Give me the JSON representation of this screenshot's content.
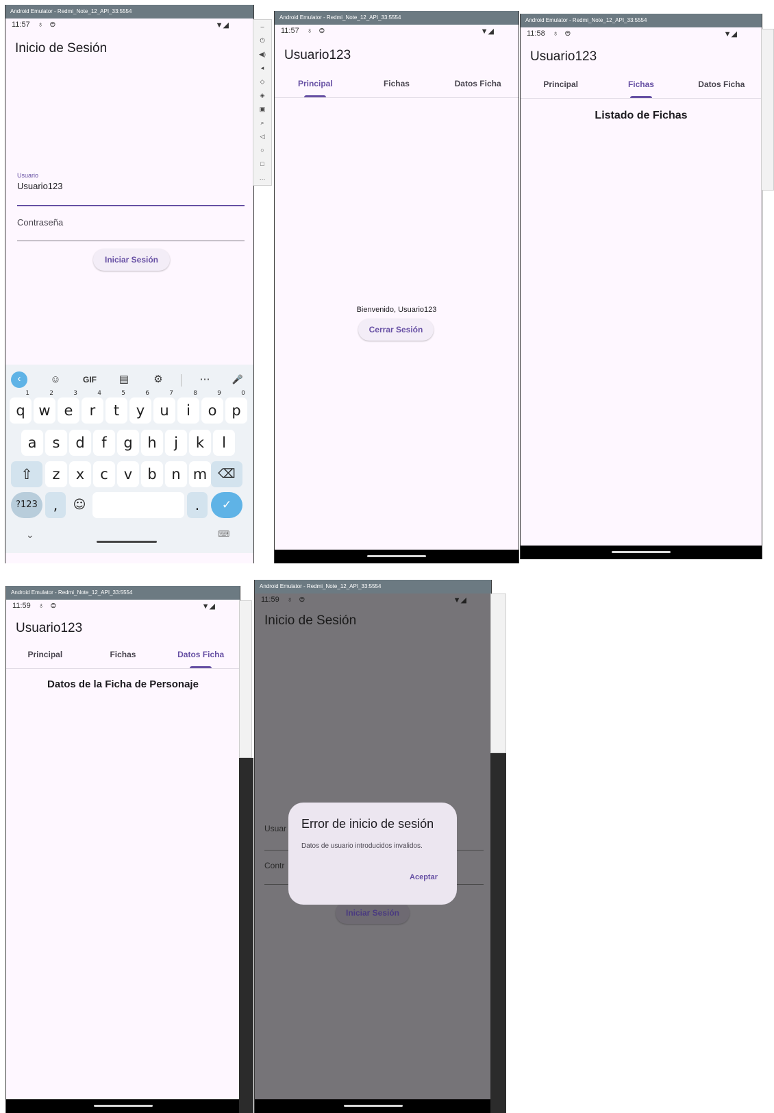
{
  "emulator_title": "Android Emulator - Redmi_Note_12_API_33:5554",
  "status_icons": "♁ ⊜",
  "signal": "▼◢",
  "side_panel_icons": [
    "–",
    "⏻",
    "◀)",
    "◂",
    "◇",
    "◈",
    "▣",
    "⌕",
    "◁",
    "○",
    "□",
    "…"
  ],
  "login": {
    "time": "11:57",
    "title": "Inicio de Sesión",
    "user_label": "Usuario",
    "user_value": "Usuario123",
    "password_placeholder": "Contraseña",
    "login_button": "Iniciar Sesión"
  },
  "keyboard": {
    "toolbar": [
      "‹",
      "☺",
      "GIF",
      "▤",
      "⚙",
      "⋯",
      "🎤"
    ],
    "row1": [
      "q",
      "w",
      "e",
      "r",
      "t",
      "y",
      "u",
      "i",
      "o",
      "p"
    ],
    "row1_hints": [
      "1",
      "2",
      "3",
      "4",
      "5",
      "6",
      "7",
      "8",
      "9",
      "0"
    ],
    "row2": [
      "a",
      "s",
      "d",
      "f",
      "g",
      "h",
      "j",
      "k",
      "l"
    ],
    "row3": [
      "z",
      "x",
      "c",
      "v",
      "b",
      "n",
      "m"
    ],
    "shift": "⇧",
    "backspace": "⌫",
    "symbols": "?123",
    "comma": ",",
    "emoji": "☺",
    "period": ".",
    "enter": "✓",
    "collapse": "⌄",
    "keyboard_switch": "⌨"
  },
  "principal": {
    "time": "11:57",
    "title": "Usuario123",
    "tabs": [
      "Principal",
      "Fichas",
      "Datos Ficha"
    ],
    "welcome": "Bienvenido, Usuario123",
    "logout_button": "Cerrar Sesión"
  },
  "fichas": {
    "time": "11:58",
    "title": "Usuario123",
    "tabs": [
      "Principal",
      "Fichas",
      "Datos Ficha"
    ],
    "heading": "Listado de Fichas"
  },
  "datos": {
    "time": "11:59",
    "title": "Usuario123",
    "tabs": [
      "Principal",
      "Fichas",
      "Datos Ficha"
    ],
    "heading": "Datos de la Ficha de Personaje"
  },
  "error": {
    "time": "11:59",
    "title": "Inicio de Sesión",
    "user_label_clipped": "Usuar",
    "password_clipped": "Contr",
    "login_button": "Iniciar Sesión",
    "dialog_title": "Error de inicio de sesión",
    "dialog_message": "Datos de usuario introducidos invalidos.",
    "dialog_button": "Aceptar"
  },
  "colors": {
    "primary": "#6750a4",
    "surface": "#fef7ff",
    "scrim": "#767478",
    "dialog": "#ece6f0"
  }
}
